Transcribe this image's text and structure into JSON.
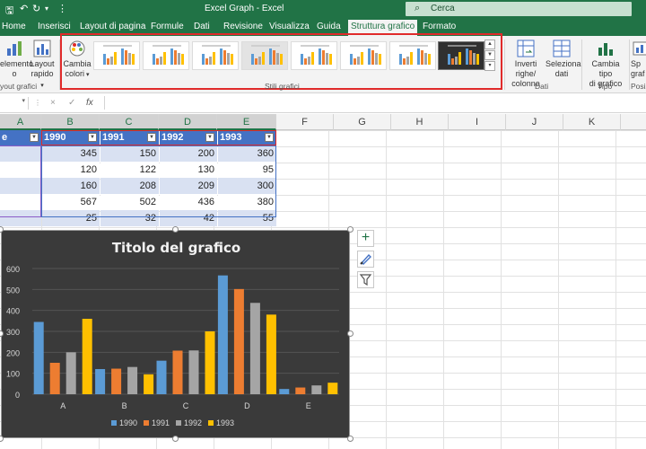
{
  "window": {
    "title": "Excel Graph  -  Excel",
    "search_placeholder": "Cerca"
  },
  "ribbon_tabs": [
    {
      "label": "Home",
      "active": false
    },
    {
      "label": "Inserisci",
      "active": false
    },
    {
      "label": "Layout di pagina",
      "active": false
    },
    {
      "label": "Formule",
      "active": false
    },
    {
      "label": "Dati",
      "active": false
    },
    {
      "label": "Revisione",
      "active": false
    },
    {
      "label": "Visualizza",
      "active": false
    },
    {
      "label": "Guida",
      "active": false
    },
    {
      "label": "Struttura grafico",
      "active": true
    },
    {
      "label": "Formato",
      "active": false
    }
  ],
  "ribbon": {
    "add_element_line1": "elemento",
    "add_element_line2": "o",
    "quick_layout_line1": "Layout",
    "quick_layout_line2": "rapido",
    "layouts_group": "yout grafici",
    "change_colors_line1": "Cambia",
    "change_colors_line2": "colori",
    "styles_group": "Stili grafici",
    "switch_line1": "Inverti righe/",
    "switch_line2": "colonne",
    "select_line1": "Seleziona",
    "select_line2": "dati",
    "data_group": "Dati",
    "change_type_line1": "Cambia tipo",
    "change_type_line2": "di grafico",
    "type_group": "Tipo",
    "move_line1": "Sp",
    "move_line2": "graf",
    "position_group": "Posiz"
  },
  "formula_bar": {
    "cancel_symbol": "×",
    "enter_symbol": "✓",
    "fx_symbol": "fx"
  },
  "columns": [
    "A",
    "B",
    "C",
    "D",
    "E",
    "F",
    "G",
    "H",
    "I",
    "J",
    "K"
  ],
  "table": {
    "first_header_fragment": "e",
    "headers": [
      "1990",
      "1991",
      "1992",
      "1993"
    ],
    "rows": [
      [
        345,
        150,
        200,
        360
      ],
      [
        120,
        122,
        130,
        95
      ],
      [
        160,
        208,
        209,
        300
      ],
      [
        567,
        502,
        436,
        380
      ],
      [
        25,
        32,
        42,
        55
      ]
    ]
  },
  "chart_data": {
    "type": "bar",
    "title": "Titolo del grafico",
    "categories": [
      "A",
      "B",
      "C",
      "D",
      "E"
    ],
    "series": [
      {
        "name": "1990",
        "color": "#5b9bd5",
        "values": [
          345,
          120,
          160,
          567,
          25
        ]
      },
      {
        "name": "1991",
        "color": "#ed7d31",
        "values": [
          150,
          122,
          208,
          502,
          32
        ]
      },
      {
        "name": "1992",
        "color": "#a5a5a5",
        "values": [
          200,
          130,
          209,
          436,
          42
        ]
      },
      {
        "name": "1993",
        "color": "#ffc000",
        "values": [
          360,
          95,
          300,
          380,
          55
        ]
      }
    ],
    "ylim": [
      0,
      600
    ],
    "yticks": [
      0,
      100,
      200,
      300,
      400,
      500,
      600
    ],
    "grid": true,
    "legend": "bottom",
    "background": "#3a3a3a"
  },
  "colors": {
    "brand": "#217346",
    "table_header": "#4472c4",
    "table_band": "#d9e1f2",
    "highlight_border": "#e02a2a"
  }
}
